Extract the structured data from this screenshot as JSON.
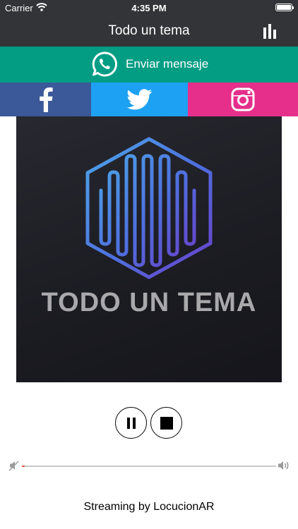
{
  "status_bar": {
    "carrier": "Carrier",
    "time": "4:35 PM",
    "battery_level": 1.0
  },
  "nav": {
    "title": "Todo un tema",
    "right_icon": "equalizer-icon"
  },
  "whatsapp": {
    "label": "Enviar mensaje",
    "icon": "whatsapp-icon",
    "color": "#039d84"
  },
  "social": [
    {
      "name": "facebook",
      "icon": "facebook-icon",
      "color": "#3b5998"
    },
    {
      "name": "twitter",
      "icon": "twitter-icon",
      "color": "#1da1f2"
    },
    {
      "name": "instagram",
      "icon": "instagram-icon",
      "color": "#e52f8a"
    }
  ],
  "cover": {
    "text": "TODO UN TEMA"
  },
  "player": {
    "pause_icon": "pause-icon",
    "stop_icon": "stop-icon"
  },
  "volume": {
    "level": 0.0,
    "accent": "#e8473b"
  },
  "footer": {
    "text": "Streaming by LocucionAR"
  }
}
